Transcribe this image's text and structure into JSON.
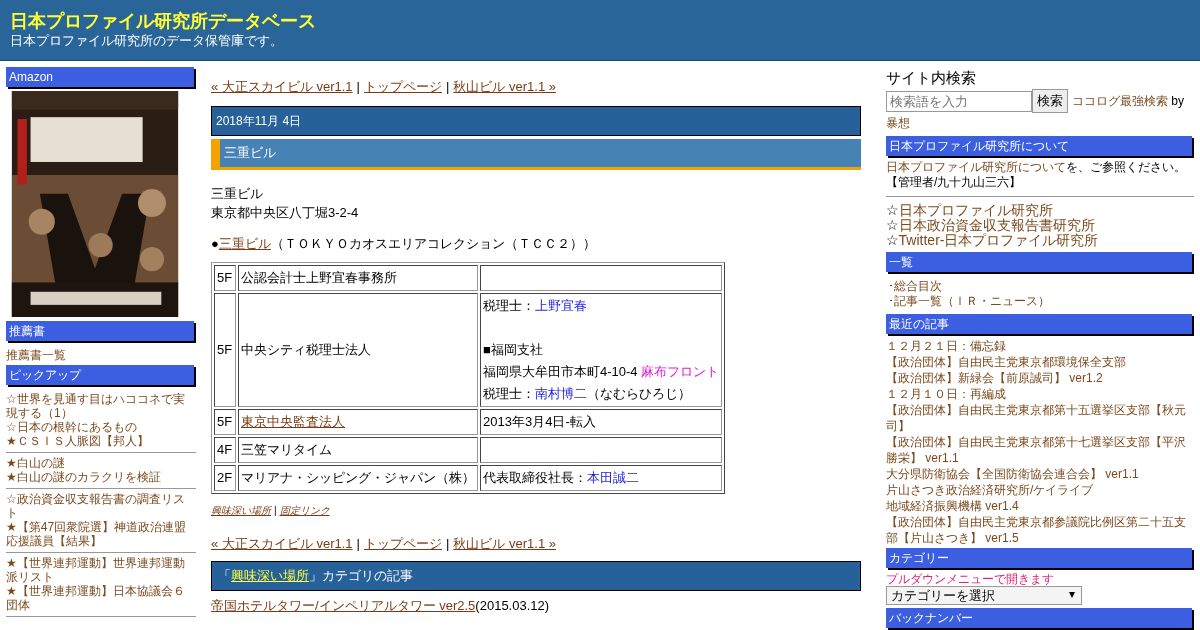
{
  "header": {
    "title": "日本プロファイル研究所データベース",
    "description": "日本プロファイル研究所のデータ保管庫です。"
  },
  "left_sidebar": {
    "sections": [
      {
        "title": "Amazon",
        "kind": "picture"
      },
      {
        "title": "推薦書",
        "kind": "links",
        "items": [
          "推薦書一覧"
        ]
      },
      {
        "title": "ピックアップ",
        "kind": "groups",
        "groups": [
          [
            "☆世界を見通す目はハココネで実現する（1）",
            "☆日本の根幹にあるもの",
            "★ＣＳＩＳ人脈図【邦人】"
          ],
          [
            "★白山の謎",
            "★白山の謎のカラクリを検証"
          ],
          [
            "☆政治資金収支報告書の調査リスト",
            "★【第47回衆院選】神道政治連盟応援議員【結果】"
          ],
          [
            "★【世界連邦運動】世界連邦運動派リスト",
            "★【世界連邦運動】日本協議会６団体"
          ]
        ]
      }
    ]
  },
  "post_nav_top": {
    "prev": "« 大正スカイビル ver1.1",
    "home": "トップページ",
    "next": "秋山ビル ver1.1 »",
    "separator": "|"
  },
  "post": {
    "date": "2018年11月 4日",
    "title": "三重ビル",
    "lines": [
      "三重ビル",
      "東京都中央区八丁堀3-2-4"
    ],
    "source": {
      "bullet": "●",
      "link": "三重ビル",
      "rest": "（ＴＯＫＹＯカオスエリアコレクション（ＴＣＣ２））"
    },
    "table": {
      "rows": [
        {
          "floor": "5F",
          "tenant": [
            {
              "text": "公認会計士上野宜春事務所",
              "kind": "plain"
            }
          ],
          "info": []
        },
        {
          "floor": "5F",
          "tenant": [
            {
              "text": "中央シティ税理士法人",
              "kind": "plain"
            }
          ],
          "info": [
            [
              {
                "text": "税理士：",
                "kind": "plain"
              },
              {
                "text": "上野宜春",
                "kind": "person"
              }
            ],
            [
              {
                "text": "■福岡支社",
                "kind": "plain"
              }
            ],
            [
              {
                "text": "福岡県大牟田市本町4-10-4 ",
                "kind": "plain"
              },
              {
                "text": "麻布フロント",
                "kind": "place"
              }
            ],
            [
              {
                "text": "税理士：",
                "kind": "plain"
              },
              {
                "text": "南村博二",
                "kind": "person"
              },
              {
                "text": "（なむらひろじ）",
                "kind": "plain"
              }
            ]
          ]
        },
        {
          "floor": "5F",
          "tenant": [
            {
              "text": "東京中央監査法人",
              "kind": "link"
            }
          ],
          "info": [
            [
              {
                "text": "2013年3月4日-転入",
                "kind": "plain"
              }
            ]
          ]
        },
        {
          "floor": "4F",
          "tenant": [
            {
              "text": "三笠マリタイム",
              "kind": "plain"
            }
          ],
          "info": []
        },
        {
          "floor": "2F",
          "tenant": [
            {
              "text": "マリアナ・シッピング・ジャパン（株）",
              "kind": "plain"
            }
          ],
          "info": [
            [
              {
                "text": "代表取締役社長：",
                "kind": "plain"
              },
              {
                "text": "本田誠二",
                "kind": "person"
              }
            ]
          ]
        }
      ]
    },
    "footer": {
      "category": "興味深い場所",
      "separator": "|",
      "permalink": "固定リンク"
    }
  },
  "post_nav_bottom": {
    "prev": "« 大正スカイビル ver1.1",
    "home": "トップページ",
    "next": "秋山ビル ver1.1 »",
    "separator": "|"
  },
  "category_articles": {
    "open": "「",
    "category": "興味深い場所",
    "rest": "」カテゴリの記事",
    "items": [
      {
        "title": "帝国ホテルタワー/インペリアルタワー ver2.5",
        "date": "(2015.03.12)"
      }
    ]
  },
  "right_sidebar": {
    "search": {
      "title": "サイト内検索",
      "placeholder": "検索語を入力",
      "button": "検索",
      "credit_link": "ココログ最強検索",
      "credit_by": " by ",
      "credit_author": "暴想"
    },
    "about": {
      "title": "日本プロファイル研究所について",
      "link": "日本プロファイル研究所について",
      "rest": "を、ご参照ください。",
      "admin": "【管理者/九十九山三六】"
    },
    "sites": [
      {
        "mark": "☆",
        "label": "日本プロファイル研究所"
      },
      {
        "mark": "☆",
        "label": "日本政治資金収支報告書研究所"
      },
      {
        "mark": "☆",
        "label": "Twitter-日本プロファイル研究所"
      }
    ],
    "index": {
      "title": "一覧",
      "items": [
        {
          "mark": "･",
          "label": "総合目次"
        },
        {
          "mark": "･",
          "label": "記事一覧（ＩＲ・ニュース）"
        }
      ]
    },
    "recent": {
      "title": "最近の記事",
      "items": [
        "１２月２１日：備忘録",
        "【政治団体】自由民主党東京都環境保全支部",
        "【政治団体】新緑会【前原誠司】 ver1.2",
        "１２月１０日：再編成",
        "【政治団体】自由民主党東京都第十五選挙区支部【秋元司】",
        "【政治団体】自由民主党東京都第十七選挙区支部【平沢勝栄】 ver1.1",
        "大分県防衛協会【全国防衛協会連合会】 ver1.1",
        "片山さつき政治経済研究所/ケイライブ",
        "地域経済振興機構 ver1.4",
        "【政治団体】自由民主党東京都参議院比例区第二十五支部【片山さつき】 ver1.5"
      ]
    },
    "categories": {
      "title": "カテゴリー",
      "hint": "プルダウンメニューで開きます",
      "select": "カテゴリーを選択"
    },
    "backnumber": {
      "title": "バックナンバー"
    }
  }
}
